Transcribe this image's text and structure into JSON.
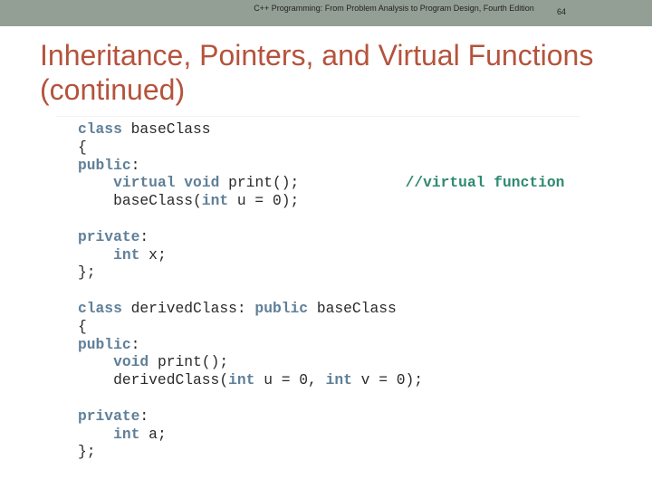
{
  "header": {
    "caption": "C++ Programming: From Problem Analysis to Program Design, Fourth Edition",
    "page_number": "64"
  },
  "title": "Inheritance, Pointers, and Virtual Functions (continued)",
  "colors": {
    "header_bar": "#939f94",
    "title": "#b5533c",
    "keyword": "#5f7f98",
    "comment": "#2e8a72",
    "code_text": "#2a2a2a"
  },
  "code_lines": [
    [
      {
        "t": "class",
        "k": "kw"
      },
      {
        "t": " baseClass",
        "k": ""
      }
    ],
    [
      {
        "t": "{",
        "k": ""
      }
    ],
    [
      {
        "t": "public",
        "k": "kw"
      },
      {
        "t": ":",
        "k": ""
      }
    ],
    [
      {
        "t": "    ",
        "k": ""
      },
      {
        "t": "virtual",
        "k": "kw"
      },
      {
        "t": " ",
        "k": ""
      },
      {
        "t": "void",
        "k": "kw"
      },
      {
        "t": " print();            ",
        "k": ""
      },
      {
        "t": "//virtual function",
        "k": "cm"
      }
    ],
    [
      {
        "t": "    baseClass(",
        "k": ""
      },
      {
        "t": "int",
        "k": "kw"
      },
      {
        "t": " u = 0);",
        "k": ""
      }
    ],
    [
      {
        "t": "",
        "k": ""
      }
    ],
    [
      {
        "t": "private",
        "k": "kw"
      },
      {
        "t": ":",
        "k": ""
      }
    ],
    [
      {
        "t": "    ",
        "k": ""
      },
      {
        "t": "int",
        "k": "kw"
      },
      {
        "t": " x;",
        "k": ""
      }
    ],
    [
      {
        "t": "};",
        "k": ""
      }
    ],
    [
      {
        "t": "",
        "k": ""
      }
    ],
    [
      {
        "t": "class",
        "k": "kw"
      },
      {
        "t": " derivedClass: ",
        "k": ""
      },
      {
        "t": "public",
        "k": "kw"
      },
      {
        "t": " baseClass",
        "k": ""
      }
    ],
    [
      {
        "t": "{",
        "k": ""
      }
    ],
    [
      {
        "t": "public",
        "k": "kw"
      },
      {
        "t": ":",
        "k": ""
      }
    ],
    [
      {
        "t": "    ",
        "k": ""
      },
      {
        "t": "void",
        "k": "kw"
      },
      {
        "t": " print();",
        "k": ""
      }
    ],
    [
      {
        "t": "    derivedClass(",
        "k": ""
      },
      {
        "t": "int",
        "k": "kw"
      },
      {
        "t": " u = 0, ",
        "k": ""
      },
      {
        "t": "int",
        "k": "kw"
      },
      {
        "t": " v = 0);",
        "k": ""
      }
    ],
    [
      {
        "t": "",
        "k": ""
      }
    ],
    [
      {
        "t": "private",
        "k": "kw"
      },
      {
        "t": ":",
        "k": ""
      }
    ],
    [
      {
        "t": "    ",
        "k": ""
      },
      {
        "t": "int",
        "k": "kw"
      },
      {
        "t": " a;",
        "k": ""
      }
    ],
    [
      {
        "t": "};",
        "k": ""
      }
    ]
  ]
}
